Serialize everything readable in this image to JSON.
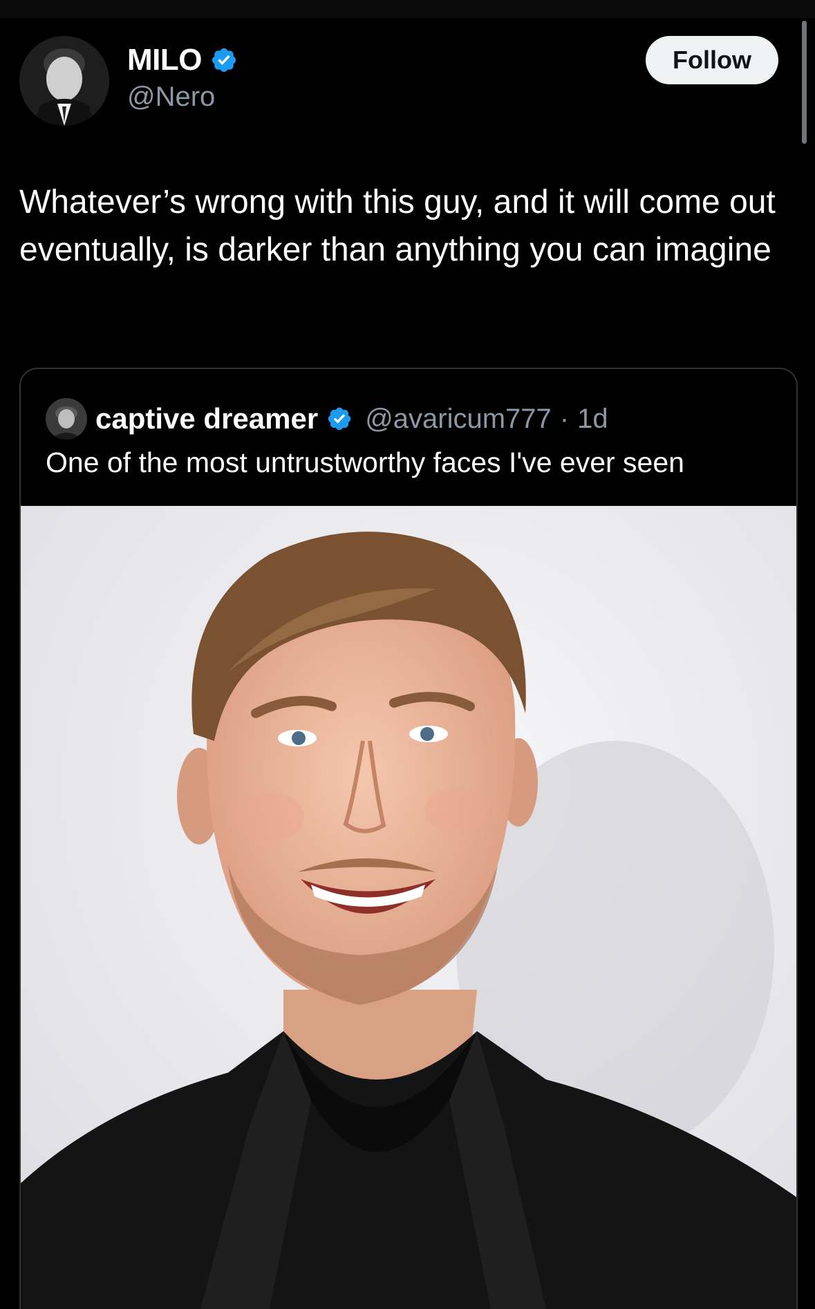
{
  "author": {
    "display_name": "MILO",
    "handle": "@Nero",
    "verified": true,
    "follow_label": "Follow"
  },
  "tweet": {
    "text": "Whatever’s wrong with this guy, and it will come out eventually, is darker than anything you can imagine"
  },
  "quoted_tweet": {
    "display_name": "captive dreamer",
    "verified": true,
    "handle": "@avaricum777",
    "separator": "·",
    "time": "1d",
    "text": "One of the most untrustworthy faces I've ever seen",
    "image": {
      "subject": "smiling-man-photo",
      "background_color": "#f0f0f3"
    }
  },
  "colors": {
    "background": "#000000",
    "text_primary": "#ffffff",
    "text_secondary": "#8b98a5",
    "verified_blue": "#1d9bf0",
    "follow_bg": "#eff3f4",
    "follow_text": "#0f1419",
    "card_border": "#2f3336"
  }
}
